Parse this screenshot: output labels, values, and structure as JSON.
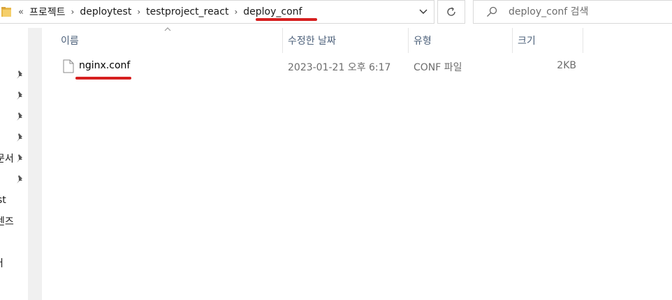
{
  "address_bar": {
    "overflow_glyph": "«",
    "crumbs": [
      "프로젝트",
      "deploytest",
      "testproject_react",
      "deploy_conf"
    ],
    "separator": "›",
    "dropdown_glyph": "⌄"
  },
  "search": {
    "placeholder": "deploy_conf 검색"
  },
  "nav": {
    "partial_items": [
      "문서",
      "st",
      "렌즈",
      "버"
    ]
  },
  "columns": {
    "name": "이름",
    "date": "수정한 날짜",
    "type": "유형",
    "size": "크기"
  },
  "files": [
    {
      "name": "nginx.conf",
      "modified": "2023-01-21 오후 6:17",
      "type": "CONF 파일",
      "size": "2KB"
    }
  ],
  "colors": {
    "annotation_red": "#d61f1f",
    "header_text": "#4c607a"
  },
  "icons": [
    "folder-icon",
    "refresh-icon",
    "search-icon",
    "pin-icon",
    "file-icon",
    "sort-up-icon"
  ]
}
